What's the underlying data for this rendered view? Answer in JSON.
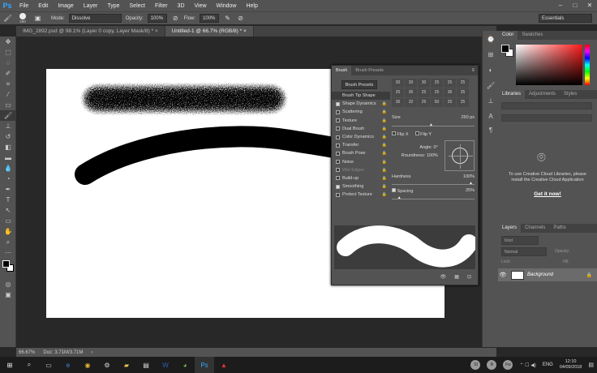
{
  "menu": {
    "logo": "Ps",
    "items": [
      "File",
      "Edit",
      "Image",
      "Layer",
      "Type",
      "Select",
      "Filter",
      "3D",
      "View",
      "Window",
      "Help"
    ]
  },
  "options": {
    "brush_size": "250",
    "mode_label": "Mode:",
    "mode_value": "Dissolve",
    "opacity_label": "Opacity:",
    "opacity_value": "100%",
    "flow_label": "Flow:",
    "flow_value": "100%",
    "workspace": "Essentials"
  },
  "tabs": [
    {
      "label": "IMG_2892.psd @ 98.1% (Layer 0 copy, Layer Mask/8) *"
    },
    {
      "label": "Untitled-1 @ 66.7% (RGB/8) *"
    }
  ],
  "status": {
    "zoom": "66.67%",
    "doc": "Doc: 3.71M/3.71M"
  },
  "brush_panel": {
    "tab1": "Brush",
    "tab2": "Brush Presets",
    "presets_button": "Brush Presets",
    "list": [
      {
        "label": "Brush Tip Shape",
        "checkbox": null
      },
      {
        "label": "Shape Dynamics",
        "checkbox": true
      },
      {
        "label": "Scattering",
        "checkbox": false
      },
      {
        "label": "Texture",
        "checkbox": false
      },
      {
        "label": "Dual Brush",
        "checkbox": false
      },
      {
        "label": "Color Dynamics",
        "checkbox": false
      },
      {
        "label": "Transfer",
        "checkbox": false
      },
      {
        "label": "Brush Pose",
        "checkbox": false
      },
      {
        "label": "Noise",
        "checkbox": false
      },
      {
        "label": "Wet Edges",
        "checkbox": false
      },
      {
        "label": "Build-up",
        "checkbox": false
      },
      {
        "label": "Smoothing",
        "checkbox": true
      },
      {
        "label": "Protect Texture",
        "checkbox": false
      }
    ],
    "tips": [
      "30",
      "30",
      "30",
      "25",
      "25",
      "25",
      "25",
      "36",
      "25",
      "25",
      "36",
      "25",
      "36",
      "32",
      "25",
      "50",
      "25",
      "25"
    ],
    "size_label": "Size",
    "size_value": "250 px",
    "flipx": "Flip X",
    "flipy": "Flip Y",
    "angle_label": "Angle:",
    "angle_value": "0°",
    "roundness_label": "Roundness:",
    "roundness_value": "100%",
    "hardness_label": "Hardness",
    "hardness_value": "100%",
    "spacing_label": "Spacing",
    "spacing_value": "25%",
    "size_fraction": 0.5,
    "hardness_fraction": 1.0,
    "spacing_fraction": 0.1
  },
  "color_panel": {
    "tab1": "Color",
    "tab2": "Swatches"
  },
  "libraries_panel": {
    "tab1": "Libraries",
    "tab2": "Adjustments",
    "tab3": "Styles",
    "message": "To use Creative Cloud Libraries, please install the Creative Cloud Application",
    "link": "Get it now!"
  },
  "layers_panel": {
    "tab1": "Layers",
    "tab2": "Channels",
    "tab3": "Paths",
    "kind": "Kind",
    "blend": "Normal",
    "opacity_label": "Opacity:",
    "lock_label": "Lock:",
    "fill_label": "Fill:",
    "layer_name": "Background"
  },
  "taskbar": {
    "time": "12:10",
    "date": "04/09/2018",
    "lang": "ENG",
    "avatars": [
      "Sl",
      "R",
      "Fw"
    ]
  },
  "colors": {
    "accent": "#31a8ff"
  }
}
